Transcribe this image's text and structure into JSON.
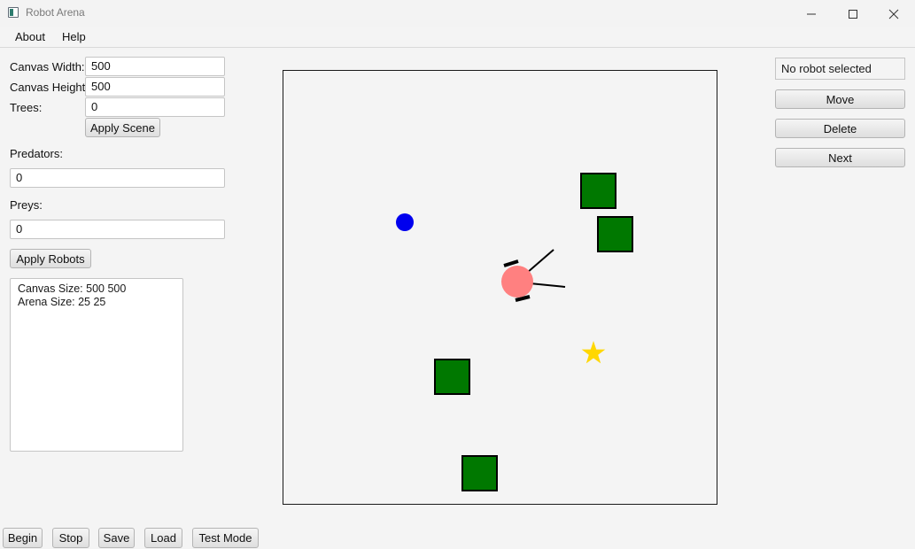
{
  "window": {
    "title": "Robot Arena"
  },
  "menu": {
    "about": "About",
    "help": "Help"
  },
  "scene_form": {
    "canvas_width_label": "Canvas Width:",
    "canvas_width_value": "500",
    "canvas_height_label": "Canvas Height:",
    "canvas_height_value": "500",
    "trees_label": "Trees:",
    "trees_value": "0",
    "apply_scene_label": "Apply Scene"
  },
  "robots_form": {
    "predators_label": "Predators:",
    "predators_value": "0",
    "preys_label": "Preys:",
    "preys_value": "0",
    "apply_robots_label": "Apply Robots"
  },
  "info": {
    "line1": "Canvas Size: 500 500",
    "line2": "Arena Size: 25 25"
  },
  "selection": {
    "status": "No robot selected",
    "move_label": "Move",
    "delete_label": "Delete",
    "next_label": "Next"
  },
  "bottom_bar": {
    "begin": "Begin",
    "stop": "Stop",
    "save": "Save",
    "load": "Load",
    "test_mode": "Test Mode"
  },
  "arena": {
    "colors": {
      "background": "#f4f4f4",
      "border": "#1a1a1a",
      "obstacle": "#007800",
      "predator": "#ff8080",
      "prey": "#0000ee",
      "target_star": "#ffd700"
    },
    "objects": {
      "obstacles": 4,
      "predators_shown": 1,
      "preys_shown": 1,
      "stars": 1
    }
  }
}
